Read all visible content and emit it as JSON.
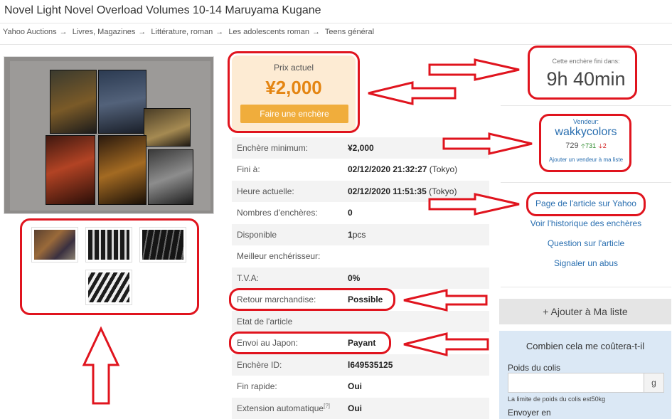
{
  "title": "Novel Light Novel Overload Volumes 10-14 Maruyama Kugane",
  "breadcrumb": [
    "Yahoo Auctions",
    "Livres, Magazines",
    "Littérature, roman",
    "Les adolescents roman",
    "Teens général"
  ],
  "breadcrumb_separator": "→",
  "price": {
    "label": "Prix actuel",
    "value": "¥2,000",
    "bid_button": "Faire une enchère"
  },
  "details": [
    {
      "key": "Enchère minimum:",
      "value": "¥2,000",
      "suffix": ""
    },
    {
      "key": "Fini à:",
      "value": "02/12/2020 21:32:27",
      "suffix": " (Tokyo)"
    },
    {
      "key": "Heure actuelle:",
      "value": "02/12/2020 11:51:35",
      "suffix": " (Tokyo)"
    },
    {
      "key": "Nombres d'enchères:",
      "value": "0",
      "suffix": ""
    },
    {
      "key": "Disponible",
      "value": "1",
      "suffix": "pcs"
    },
    {
      "key": "Meilleur enchérisseur:",
      "value": "",
      "suffix": ""
    },
    {
      "key": "T.V.A:",
      "value": "0%",
      "suffix": ""
    },
    {
      "key": "Retour marchandise:",
      "value": "Possible",
      "suffix": ""
    },
    {
      "key": "Etat de l'article",
      "value": "",
      "suffix": ""
    },
    {
      "key": "Envoi au Japon:",
      "value": "Payant",
      "suffix": ""
    },
    {
      "key": "Enchère ID:",
      "value": "l649535125",
      "suffix": ""
    },
    {
      "key": "Fin rapide:",
      "value": "Oui",
      "suffix": ""
    },
    {
      "key": "Extension automatique",
      "key_sup": "[?]",
      "value": "Oui",
      "suffix": ""
    }
  ],
  "timer": {
    "label": "Cette enchère fini dans:",
    "value": "9h 40min"
  },
  "seller": {
    "label": "Vendeur:",
    "name": "wakkycolors",
    "rating": "729",
    "positive": "731",
    "negative": "2",
    "add_link": "Ajouter un vendeur à ma liste"
  },
  "links": [
    "Page de l'article sur Yahoo",
    "Voir l'historique des enchères",
    "Question sur l'article",
    "Signaler un abus"
  ],
  "add_to_list": "+ Ajouter à Ma liste",
  "calculator": {
    "title": "Combien cela me coûtera-t-il",
    "weight_label": "Poids du colis",
    "unit": "g",
    "limit": "La limite de poids du colis est50kg",
    "ship_label": "Envoyer en"
  },
  "icons": [
    "arrow-up-icon",
    "arrow-down-icon"
  ],
  "colors": {
    "accent": "#e48512",
    "annotation": "#e0141e",
    "link": "#2a6fb0",
    "price_bg": "#fdebd3",
    "calc_bg": "#dbe8f5"
  }
}
